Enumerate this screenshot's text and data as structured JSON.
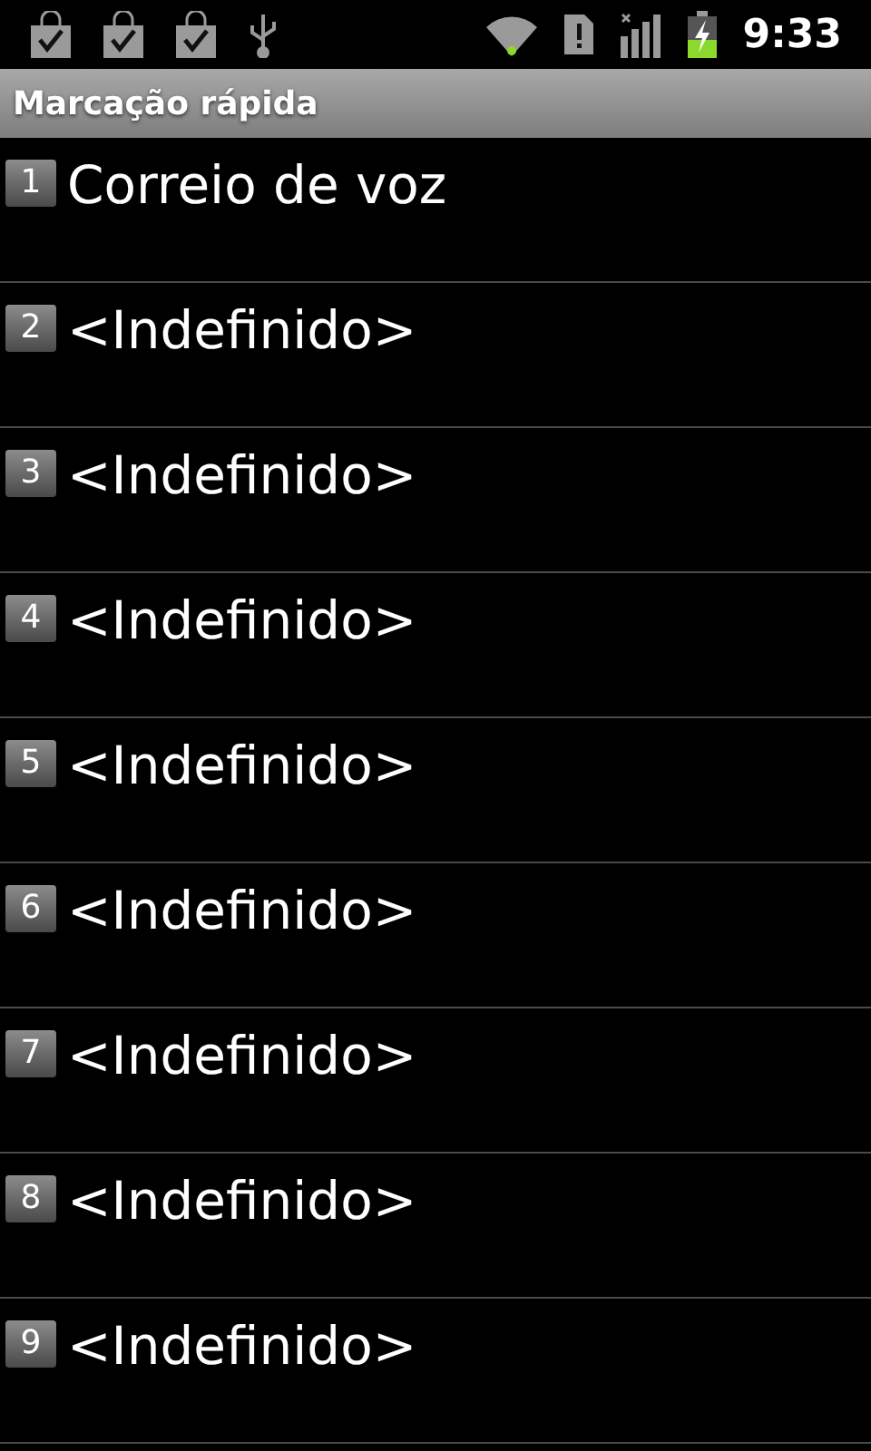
{
  "status_bar": {
    "time": "9:33"
  },
  "title": "Marcação rápida",
  "items": [
    {
      "key": "1",
      "label": "Correio de voz"
    },
    {
      "key": "2",
      "label": "<Indefinido>"
    },
    {
      "key": "3",
      "label": "<Indefinido>"
    },
    {
      "key": "4",
      "label": "<Indefinido>"
    },
    {
      "key": "5",
      "label": "<Indefinido>"
    },
    {
      "key": "6",
      "label": "<Indefinido>"
    },
    {
      "key": "7",
      "label": "<Indefinido>"
    },
    {
      "key": "8",
      "label": "<Indefinido>"
    },
    {
      "key": "9",
      "label": "<Indefinido>"
    }
  ]
}
